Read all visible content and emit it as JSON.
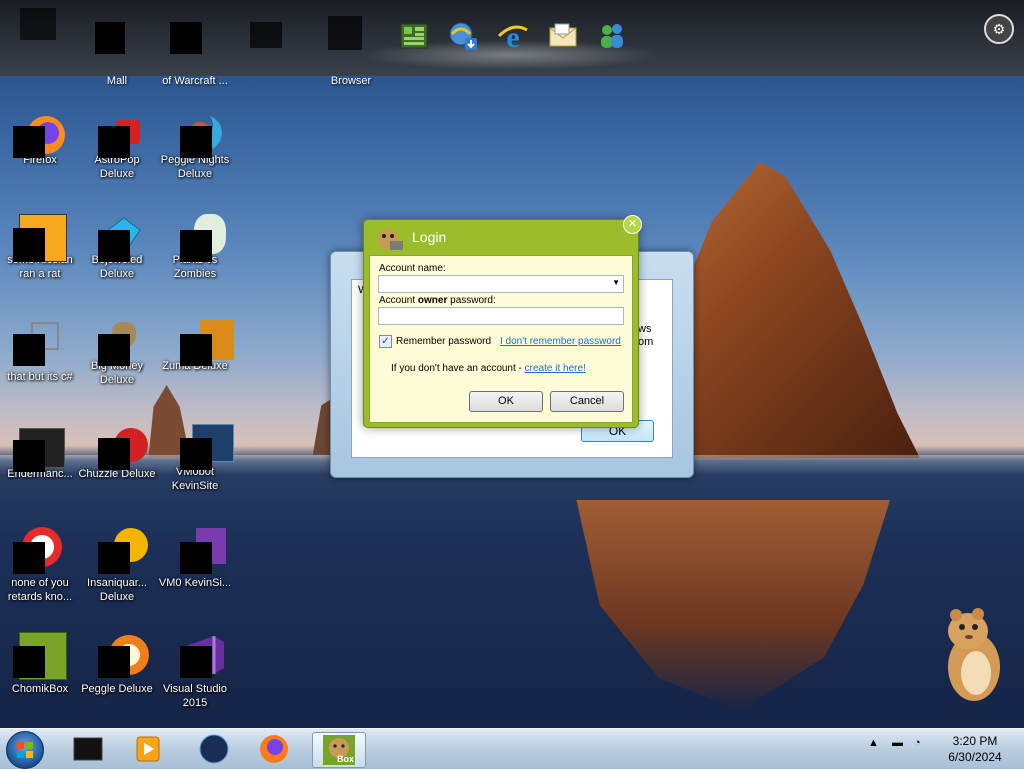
{
  "top_dock": {
    "labels": [
      "Mall",
      "of Warcraft ...",
      "Browser"
    ],
    "icons": [
      "minecraft-icon",
      "ie-download-icon",
      "internet-explorer-icon",
      "mail-icon",
      "messenger-icon"
    ]
  },
  "desktop_icons": [
    {
      "label": "Firefox",
      "icon": "firefox-icon"
    },
    {
      "label": "AstroPop Deluxe",
      "icon": "astropop-icon"
    },
    {
      "label": "Peggle Nights Deluxe",
      "icon": "peggle-nights-icon"
    },
    {
      "label": "some russian ran a rat",
      "icon": "generic-app-icon"
    },
    {
      "label": "Bejeweled Deluxe",
      "icon": "bejeweled-icon"
    },
    {
      "label": "Plants vs Zombies",
      "icon": "pvz-icon"
    },
    {
      "label": "that but its c#",
      "icon": "shortcut-icon"
    },
    {
      "label": "Big Money Deluxe",
      "icon": "big-money-icon"
    },
    {
      "label": "Zuma Deluxe",
      "icon": "zuma-icon"
    },
    {
      "label": "Endermanc...",
      "icon": "terminal-icon"
    },
    {
      "label": "Chuzzle Deluxe",
      "icon": "chuzzle-icon"
    },
    {
      "label": "VM0b0t KevinSite",
      "icon": "vm-icon"
    },
    {
      "label": "none of you retards kno...",
      "icon": "peggle-icon"
    },
    {
      "label": "Insaniquar... Deluxe",
      "icon": "insaniquarium-icon"
    },
    {
      "label": "VM0 KevinSi...",
      "icon": "vs-icon"
    },
    {
      "label": "ChomikBox",
      "icon": "chomikbox-icon"
    },
    {
      "label": "Peggle Deluxe",
      "icon": "peggle-deluxe-icon"
    },
    {
      "label": "Visual Studio 2015",
      "icon": "visual-studio-icon"
    }
  ],
  "background_dialog": {
    "title_fragment": "W",
    "text_fragments": [
      "ws",
      "om"
    ],
    "ok_label": "OK"
  },
  "login_dialog": {
    "title": "Login",
    "account_name_label": "Account name:",
    "account_name_value": "",
    "password_label_prefix": "Account ",
    "password_label_bold": "owner",
    "password_label_suffix": " password:",
    "password_value": "",
    "remember_label": "Remember password",
    "remember_checked": true,
    "forgot_link": "I don't remember password",
    "no_account_text": "If you don't have an account - ",
    "create_link": "create it here!",
    "ok_label": "OK",
    "cancel_label": "Cancel"
  },
  "taskbar": {
    "apps": [
      "file-manager-icon",
      "media-player-icon",
      "globe-icon",
      "firefox-icon",
      "chomikbox-icon"
    ],
    "active_app": "Box",
    "time": "3:20 PM",
    "date": "6/30/2024"
  }
}
